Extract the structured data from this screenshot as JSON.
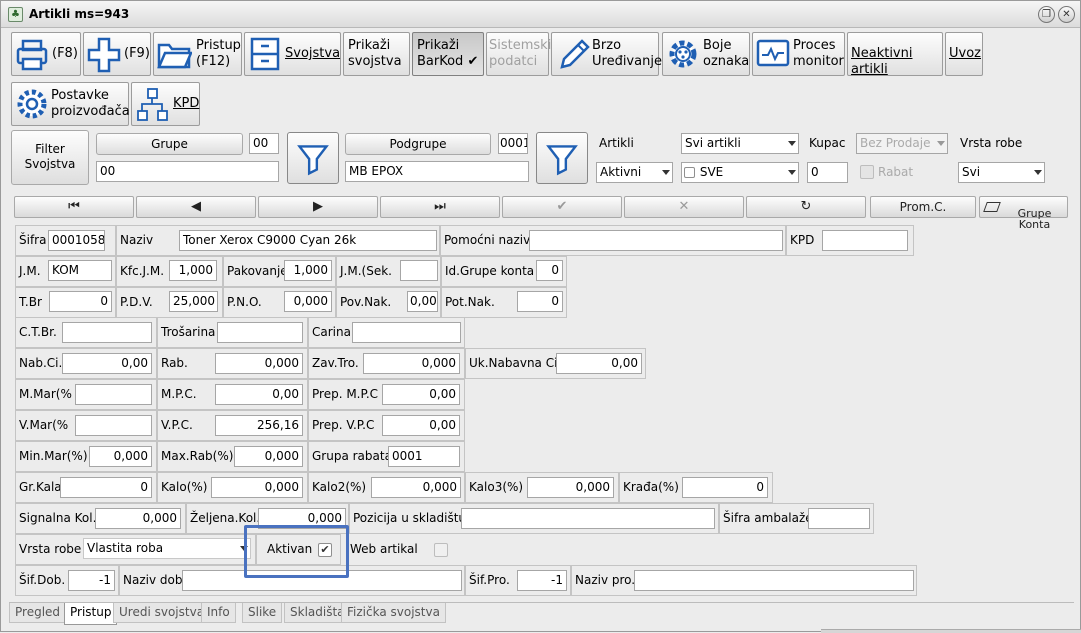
{
  "window": {
    "title": "Artikli ms=943"
  },
  "toolbar": {
    "print": "(F8)",
    "add": "(F9)",
    "pristup": "Pristup\n(F12)",
    "svojstva": "Svojstva",
    "prikazi_svojstva": "Prikaži\nsvojstva",
    "prikazi_barkod": "Prikaži\nBarKod ✔",
    "sistemski": "Sistemski\npodatci",
    "brzo": "Brzo\nUređivanje",
    "boje": "Boje\noznaka",
    "proces": "Proces\nmonitor",
    "neaktivni": "Neaktivni artikli",
    "uvoz": "Uvoz",
    "postavke": "Postavke\nproizvođača",
    "kpd": "KPD"
  },
  "filter": {
    "filter_btn": "Filter\nSvojstva",
    "grupe_btn": "Grupe",
    "grupe_code": "00",
    "grupe_value": "00",
    "podgrupe_btn": "Podgrupe",
    "podgrupe_code": "0001",
    "podgrupe_value": "MB EPOX",
    "artikli_label": "Artikli",
    "artikli_select": "Svi artikli",
    "artikli_status": "Aktivni",
    "sve_label": "SVE",
    "kupac_label": "Kupac",
    "kupac_select": "Bez Prodaje",
    "kupac_value": "0",
    "rabat_label": "Rabat",
    "vrsta_robe_label": "Vrsta robe",
    "vrsta_robe_select": "Svi"
  },
  "nav": {
    "first": "⏮",
    "prev": "◀",
    "next": "▶",
    "last": "⏭",
    "confirm": "✔",
    "cancel": "✕",
    "refresh": "↻",
    "promc": "Prom.C.",
    "grupe_konta": "Grupe\nKonta"
  },
  "form": {
    "sifra_label": "Šifra",
    "sifra": "0001058",
    "naziv_label": "Naziv",
    "naziv": "Toner Xerox  C9000 Cyan 26k",
    "pomocni_label": "Pomoćni naziv",
    "pomocni": "",
    "kpd_label": "KPD",
    "kpd": "",
    "jm_label": "J.M.",
    "jm": "KOM",
    "kfc_label": "Kfc.J.M.",
    "kfc": "1,000",
    "pakovanje_label": "Pakovanje",
    "pakovanje": "1,000",
    "jmsek_label": "J.M.(Sek.",
    "jmsek": "",
    "idgrupe_label": "Id.Grupe konta",
    "idgrupe": "0",
    "tbr_label": "T.Br",
    "tbr": "0",
    "pdv_label": "P.D.V.",
    "pdv": "25,000",
    "pno_label": "P.N.O.",
    "pno": "0,000",
    "povnak_label": "Pov.Nak.",
    "povnak": "0,00",
    "potnak_label": "Pot.Nak.",
    "potnak": "0",
    "ctbr_label": "C.T.Br.",
    "ctbr": "",
    "trosarina_label": "Trošarina",
    "trosarina": "",
    "carina_label": "Carina",
    "carina": "",
    "nabci_label": "Nab.Ci.",
    "nabci": "0,00",
    "rab_label": "Rab.",
    "rab": "0,000",
    "zavtro_label": "Zav.Tro.",
    "zavtro": "0,000",
    "uknab_label": "Uk.Nabavna Ci.",
    "uknab": "0,00",
    "mmar_label": "M.Mar(%",
    "mmar": "",
    "mpc_label": "M.P.C.",
    "mpc": "0,00",
    "prepmpc_label": "Prep. M.P.C",
    "prepmpc": "0,00",
    "vmar_label": "V.Mar(%",
    "vmar": "",
    "vpc_label": "V.P.C.",
    "vpc": "256,16",
    "prepvpc_label": "Prep. V.P.C",
    "prepvpc": "0,00",
    "minmar_label": "Min.Mar(%)",
    "minmar": "0,000",
    "maxrab_label": "Max.Rab(%)",
    "maxrab": "0,000",
    "grupa_rabata_label": "Grupa rabata",
    "grupa_rabata": "0001",
    "grkala_label": "Gr.Kala",
    "grkala": "0",
    "kalo_label": "Kalo(%)",
    "kalo": "0,000",
    "kalo2_label": "Kalo2(%)",
    "kalo2": "0,000",
    "kalo3_label": "Kalo3(%)",
    "kalo3": "0,000",
    "krada_label": "Krađa(%)",
    "krada": "0",
    "signalna_label": "Signalna Kol.",
    "signalna": "0,000",
    "zeljena_label": "Željena.Kol.",
    "zeljena": "0,000",
    "pozicija_label": "Pozicija u skladištu",
    "pozicija": "",
    "ambalaze_label": "Šifra ambalaže",
    "ambalaze": "",
    "vrsta_robe_label": "Vrsta robe",
    "vrsta_robe": "Vlastita roba",
    "aktivan_label": "Aktivan",
    "web_label": "Web artikal",
    "sifdob_label": "Šif.Dob.",
    "sifdob": "-1",
    "nazivdob_label": "Naziv dob",
    "nazivdob": "",
    "sifpro_label": "Šif.Pro.",
    "sifpro": "-1",
    "nazivpro_label": "Naziv pro.",
    "nazivpro": ""
  },
  "tabs": [
    "Pregled",
    "Pristup",
    "Uredi svojstva",
    "Info",
    "Slike",
    "Skladišta",
    "Fizička svojstva"
  ],
  "colors": {
    "highlight": "#4a72c0",
    "toolbar_icon": "#1f5fb3"
  }
}
